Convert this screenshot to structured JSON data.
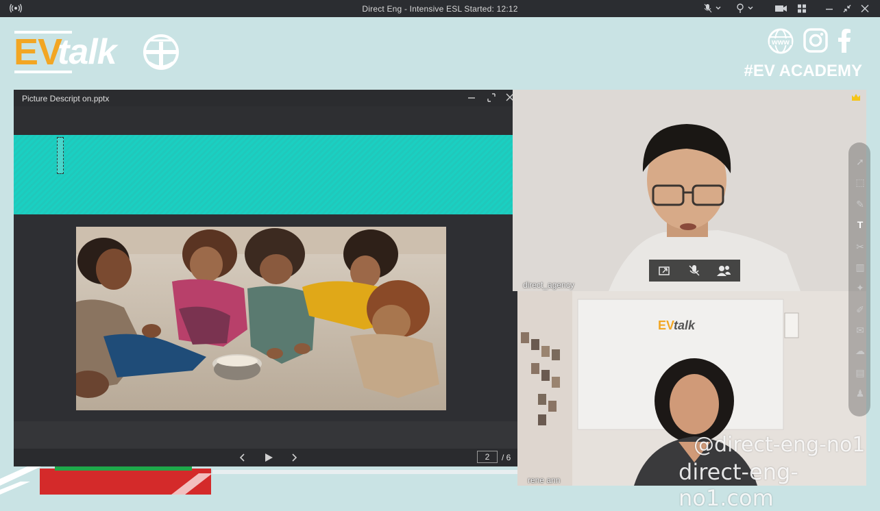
{
  "titlebar": {
    "title": "Direct Eng - Intensive ESL   Started: 12:12"
  },
  "banner": {
    "logo_ev": "EV",
    "logo_talk": "talk",
    "social_www": "www",
    "academy": "#EV ACADEMY"
  },
  "presentation": {
    "file_name": "Picture Descript on.pptx",
    "page_current": "2",
    "page_total": "/ 6"
  },
  "participants": [
    {
      "name": "direct_agency"
    },
    {
      "name": "rene ann"
    }
  ],
  "video2_logo": {
    "ev": "EV",
    "talk": "talk"
  },
  "watermark": {
    "handle": "@direct-eng-no1",
    "site": "direct-eng-no1.com"
  },
  "colors": {
    "accent_orange": "#f2a623",
    "teal": "#1ad0c2",
    "banner_bg": "#c9e3e4"
  }
}
